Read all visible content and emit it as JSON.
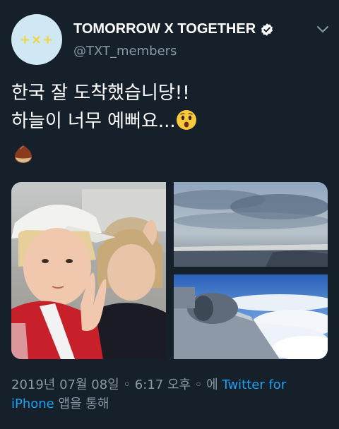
{
  "profile": {
    "display_name": "TOMORROW X TOGETHER",
    "handle": "@TXT_members",
    "avatar_mark": "+×+"
  },
  "tweet": {
    "line1": "한국 잘 도착했습니당!!",
    "line2": "하늘이 너무 예뻐요...",
    "emojis": [
      "astonished-face",
      "chestnut"
    ]
  },
  "media": {
    "photos": [
      "selfie",
      "sky-over-clouds",
      "airplane-wing-clouds"
    ]
  },
  "meta": {
    "timestamp": "2019년 07월 08일 ◦ 6:17 오후 ◦ 에",
    "source_app": "Twitter for iPhone",
    "suffix": " 앱을 통해"
  },
  "colors": {
    "background": "#15202b",
    "link": "#1da1f2",
    "muted": "#8899a6",
    "avatar_bg": "#cfe8f4",
    "avatar_mark": "#f2d53c"
  }
}
